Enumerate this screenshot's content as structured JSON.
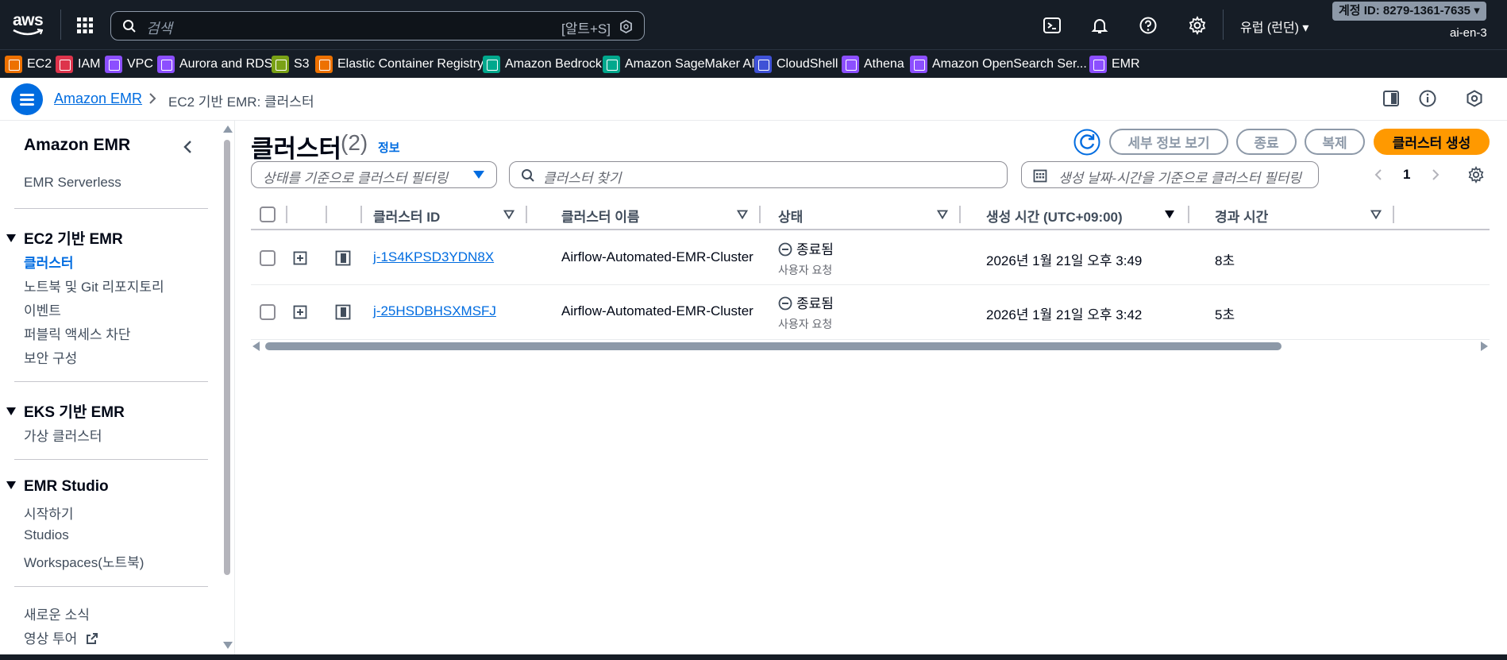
{
  "topbar": {
    "logo_text": "aws",
    "search_placeholder": "검색",
    "search_shortcut": "[알트+S]",
    "region": "유럽 (런던) ▾",
    "account_id": "계정 ID: 8279-1361-7635 ▾",
    "account_sub": "ai-en-3"
  },
  "favorites": [
    {
      "label": "EC2",
      "color": "#ed7100"
    },
    {
      "label": "IAM",
      "color": "#dd344c"
    },
    {
      "label": "VPC",
      "color": "#8c4fff"
    },
    {
      "label": "Aurora and RDS",
      "color": "#8c4fff"
    },
    {
      "label": "S3",
      "color": "#7aa116"
    },
    {
      "label": "Elastic Container Registry",
      "color": "#ed7100"
    },
    {
      "label": "Amazon Bedrock",
      "color": "#01a88d"
    },
    {
      "label": "Amazon SageMaker AI",
      "color": "#01a88d"
    },
    {
      "label": "CloudShell",
      "color": "#3f51d6"
    },
    {
      "label": "Athena",
      "color": "#8c4fff"
    },
    {
      "label": "Amazon OpenSearch Ser...",
      "color": "#8c4fff"
    },
    {
      "label": "EMR",
      "color": "#8c4fff"
    }
  ],
  "breadcrumb": {
    "root": "Amazon EMR",
    "current": "EC2 기반 EMR: 클러스터"
  },
  "sidebar": {
    "title": "Amazon EMR",
    "top_link": "EMR Serverless",
    "sections": [
      {
        "title": "EC2 기반 EMR",
        "items": [
          "클러스터",
          "노트북 및 Git 리포지토리",
          "이벤트",
          "퍼블릭 액세스 차단",
          "보안 구성"
        ],
        "active": "클러스터"
      },
      {
        "title": "EKS 기반 EMR",
        "items": [
          "가상 클러스터"
        ]
      },
      {
        "title": "EMR Studio",
        "items": [
          "시작하기",
          "Studios",
          "Workspaces(노트북)"
        ]
      }
    ],
    "footer_links": [
      "새로운 소식",
      "영상 투어"
    ]
  },
  "header": {
    "title": "클러스터",
    "count": "(2)",
    "info": "정보",
    "buttons": {
      "details": "세부 정보 보기",
      "terminate": "종료",
      "clone": "복제",
      "create": "클러스터 생성"
    }
  },
  "filters": {
    "state_placeholder": "상태를 기준으로 클러스터 필터링",
    "search_placeholder": "클러스터 찾기",
    "date_placeholder": "생성 날짜-시간을 기준으로 클러스터 필터링",
    "page": "1"
  },
  "table": {
    "columns": [
      "클러스터 ID",
      "클러스터 이름",
      "상태",
      "생성 시간 (UTC+09:00)",
      "경과 시간"
    ],
    "rows": [
      {
        "id": "j-1S4KPSD3YDN8X",
        "name": "Airflow-Automated-EMR-Cluster",
        "status": "종료됨",
        "status_reason": "사용자 요청",
        "created": "2026년 1월 21일 오후 3:49",
        "elapsed": "8초"
      },
      {
        "id": "j-25HSDBHSXMSFJ",
        "name": "Airflow-Automated-EMR-Cluster",
        "status": "종료됨",
        "status_reason": "사용자 요청",
        "created": "2026년 1월 21일 오후 3:42",
        "elapsed": "5초"
      }
    ]
  }
}
